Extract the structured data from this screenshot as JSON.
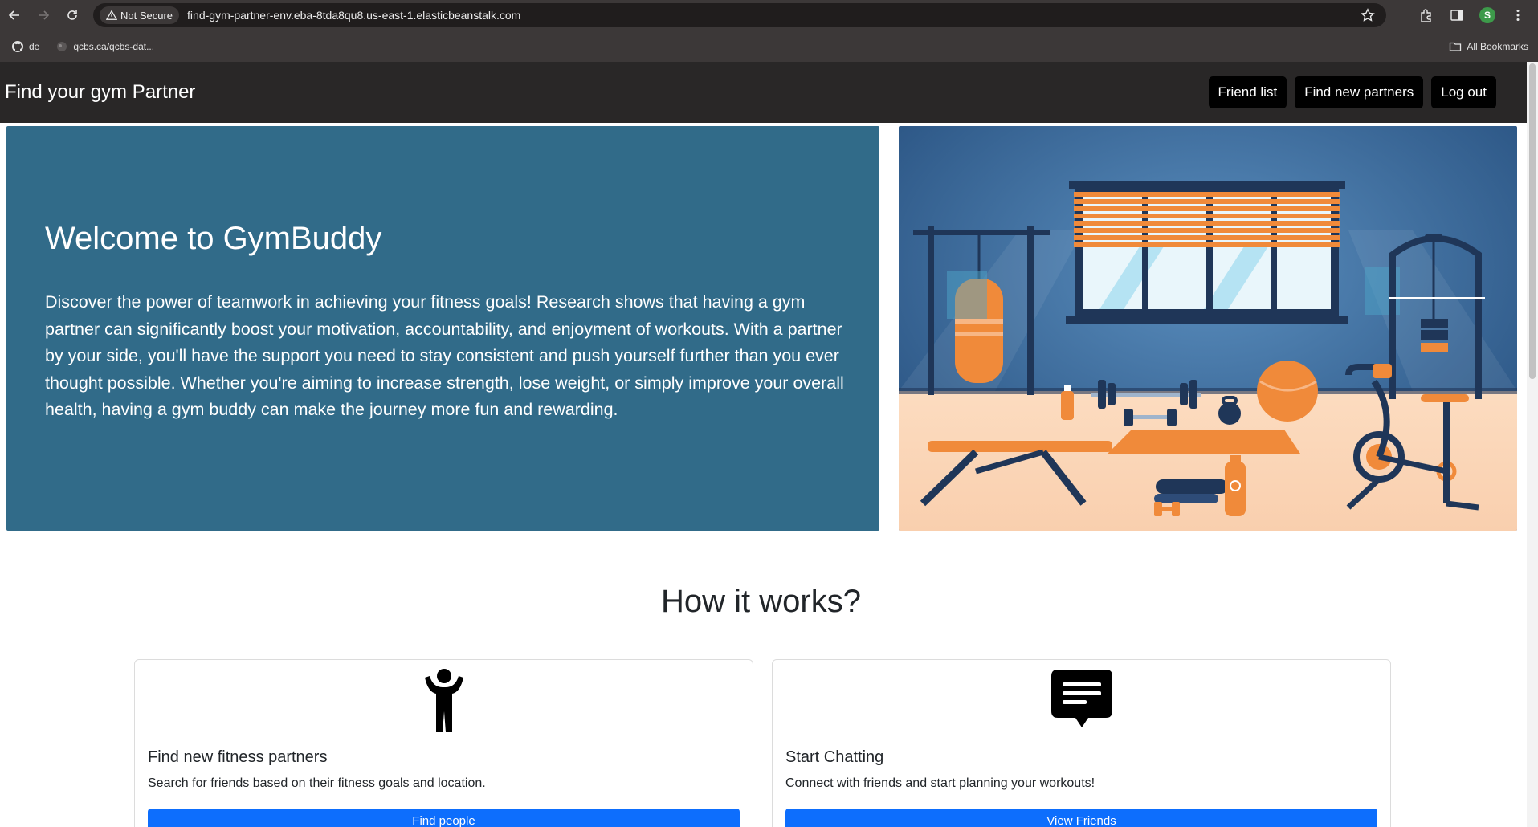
{
  "browser": {
    "security_label": "Not Secure",
    "url": "find-gym-partner-env.eba-8tda8qu8.us-east-1.elasticbeanstalk.com",
    "profile_initial": "S",
    "bookmarks": [
      {
        "label": "de",
        "icon": "github-icon"
      },
      {
        "label": "qcbs.ca/qcbs-dat...",
        "icon": "site-icon"
      }
    ],
    "all_bookmarks_label": "All Bookmarks"
  },
  "navbar": {
    "brand": "Find your gym Partner",
    "actions": [
      "Friend list",
      "Find new partners",
      "Log out"
    ]
  },
  "hero": {
    "title": "Welcome to GymBuddy",
    "body": "Discover the power of teamwork in achieving your fitness goals! Research shows that having a gym partner can significantly boost your motivation, accountability, and enjoyment of workouts. With a partner by your side, you'll have the support you need to stay consistent and push yourself further than you ever thought possible. Whether you're aiming to increase strength, lose weight, or simply improve your overall health, having a gym buddy can make the journey more fun and rewarding.",
    "background_color": "#316b89"
  },
  "how_it_works": {
    "title": "How it works?",
    "cards": [
      {
        "icon": "person-icon",
        "title": "Find new fitness partners",
        "text": "Search for friends based on their fitness goals and location.",
        "button": "Find people"
      },
      {
        "icon": "chat-icon",
        "title": "Start Chatting",
        "text": "Connect with friends and start planning your workouts!",
        "button": "View Friends"
      }
    ]
  },
  "colors": {
    "primary_button": "#0d6efd",
    "navbar": "#292727",
    "accent_orange": "#f08a3a"
  }
}
